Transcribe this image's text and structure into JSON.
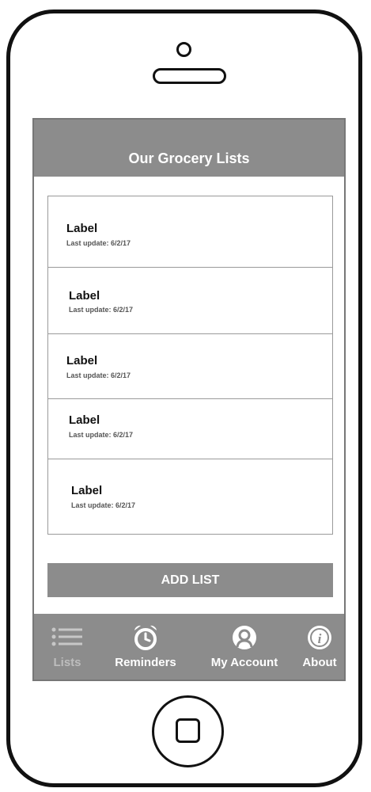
{
  "header": {
    "title": "Our Grocery Lists"
  },
  "lists": [
    {
      "label": "Label",
      "meta": "Last update: 6/2/17"
    },
    {
      "label": "Label",
      "meta": "Last update: 6/2/17"
    },
    {
      "label": "Label",
      "meta": "Last update: 6/2/17"
    },
    {
      "label": "Label",
      "meta": "Last update: 6/2/17"
    },
    {
      "label": "Label",
      "meta": "Last update: 6/2/17"
    }
  ],
  "add_button": {
    "label": "ADD LIST"
  },
  "tabs": [
    {
      "label": "Lists",
      "icon": "list-icon",
      "active": true
    },
    {
      "label": "Reminders",
      "icon": "alarm-clock-icon"
    },
    {
      "label": "My Account",
      "icon": "account-icon"
    },
    {
      "label": "About",
      "icon": "info-icon"
    }
  ],
  "colors": {
    "bar": "#8c8c8c",
    "border": "#9a9a9a",
    "text": "#111111",
    "phone": "#111111"
  }
}
